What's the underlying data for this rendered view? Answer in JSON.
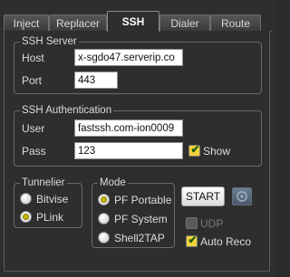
{
  "tabs": [
    {
      "label": "Inject",
      "active": false
    },
    {
      "label": "Replacer",
      "active": false
    },
    {
      "label": "SSH",
      "active": true
    },
    {
      "label": "Dialer",
      "active": false
    },
    {
      "label": "Route",
      "active": false
    }
  ],
  "ssh_server": {
    "legend": "SSH Server",
    "host_label": "Host",
    "host_value": "x-sgdo47.serverip.co",
    "port_label": "Port",
    "port_value": "443"
  },
  "ssh_auth": {
    "legend": "SSH Authentication",
    "user_label": "User",
    "user_value": "fastssh.com-ion0009",
    "pass_label": "Pass",
    "pass_value": "123",
    "show_label": "Show",
    "show_checked": true
  },
  "tunneller": {
    "legend": "Tunnelier",
    "options": [
      {
        "label": "Bitvise",
        "selected": false
      },
      {
        "label": "PLink",
        "selected": true
      }
    ]
  },
  "mode": {
    "legend": "Mode",
    "options": [
      {
        "label": "PF Portable",
        "selected": true
      },
      {
        "label": "PF System",
        "selected": false
      },
      {
        "label": "Shell2TAP",
        "selected": false
      }
    ]
  },
  "actions": {
    "start_label": "START",
    "udp_label": "UDP",
    "udp_checked": false,
    "udp_enabled": false,
    "auto_reco_label": "Auto Reco",
    "auto_reco_checked": true
  },
  "colors": {
    "background": "#2e2e2e",
    "checkbox_fill": "#f3d23a",
    "radio_dot": "#c9b500"
  }
}
